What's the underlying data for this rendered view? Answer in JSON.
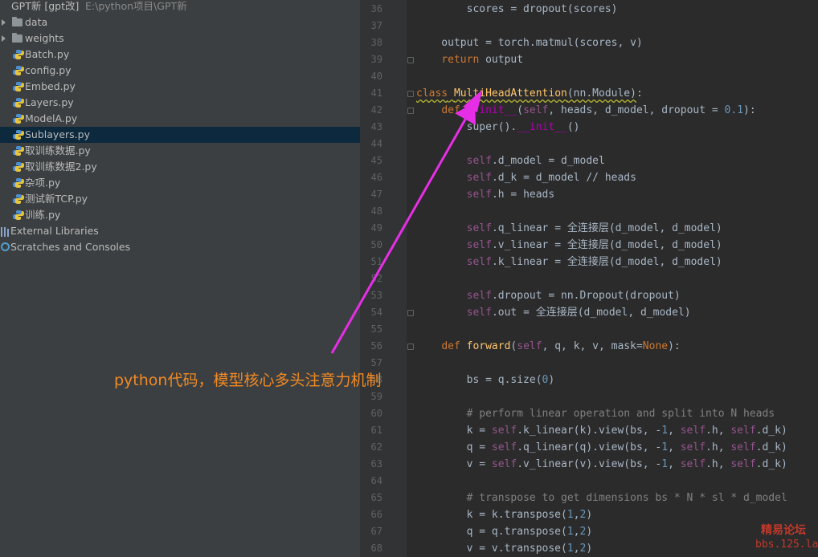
{
  "project_tree": {
    "root": {
      "name": "GPT新 [gpt改]",
      "path": "E:\\python项目\\GPT新"
    },
    "items": [
      {
        "label": "data",
        "type": "folder"
      },
      {
        "label": "weights",
        "type": "folder"
      },
      {
        "label": "Batch.py",
        "type": "py"
      },
      {
        "label": "config.py",
        "type": "py"
      },
      {
        "label": "Embed.py",
        "type": "py"
      },
      {
        "label": "Layers.py",
        "type": "py"
      },
      {
        "label": "ModelA.py",
        "type": "py"
      },
      {
        "label": "Sublayers.py",
        "type": "py",
        "selected": true
      },
      {
        "label": "取训练数据.py",
        "type": "py"
      },
      {
        "label": "取训练数据2.py",
        "type": "py"
      },
      {
        "label": "杂项.py",
        "type": "py"
      },
      {
        "label": "测试新TCP.py",
        "type": "py"
      },
      {
        "label": "训练.py",
        "type": "py"
      },
      {
        "label": "External Libraries",
        "type": "lib"
      },
      {
        "label": "Scratches and Consoles",
        "type": "scratch"
      }
    ]
  },
  "editor": {
    "lines": [
      {
        "n": "36",
        "text": "        scores = dropout(scores)"
      },
      {
        "n": "37",
        "text": ""
      },
      {
        "n": "38",
        "text": "    output = torch.matmul(scores, v)"
      },
      {
        "n": "39",
        "text": "    return output"
      },
      {
        "n": "40",
        "text": ""
      },
      {
        "n": "41",
        "text": "class MultiHeadAttention(nn.Module):"
      },
      {
        "n": "42",
        "text": "    def __init__(self, heads, d_model, dropout = 0.1):"
      },
      {
        "n": "43",
        "text": "        super().__init__()"
      },
      {
        "n": "44",
        "text": ""
      },
      {
        "n": "45",
        "text": "        self.d_model = d_model"
      },
      {
        "n": "46",
        "text": "        self.d_k = d_model // heads"
      },
      {
        "n": "47",
        "text": "        self.h = heads"
      },
      {
        "n": "48",
        "text": ""
      },
      {
        "n": "49",
        "text": "        self.q_linear = 全连接层(d_model, d_model)"
      },
      {
        "n": "50",
        "text": "        self.v_linear = 全连接层(d_model, d_model)"
      },
      {
        "n": "51",
        "text": "        self.k_linear = 全连接层(d_model, d_model)"
      },
      {
        "n": "52",
        "text": ""
      },
      {
        "n": "53",
        "text": "        self.dropout = nn.Dropout(dropout)"
      },
      {
        "n": "54",
        "text": "        self.out = 全连接层(d_model, d_model)"
      },
      {
        "n": "55",
        "text": ""
      },
      {
        "n": "56",
        "text": "    def forward(self, q, k, v, mask=None):"
      },
      {
        "n": "57",
        "text": ""
      },
      {
        "n": "58",
        "text": "        bs = q.size(0)"
      },
      {
        "n": "59",
        "text": ""
      },
      {
        "n": "60",
        "text": "        # perform linear operation and split into N heads"
      },
      {
        "n": "61",
        "text": "        k = self.k_linear(k).view(bs, -1, self.h, self.d_k)"
      },
      {
        "n": "62",
        "text": "        q = self.q_linear(q).view(bs, -1, self.h, self.d_k)"
      },
      {
        "n": "63",
        "text": "        v = self.v_linear(v).view(bs, -1, self.h, self.d_k)"
      },
      {
        "n": "64",
        "text": ""
      },
      {
        "n": "65",
        "text": "        # transpose to get dimensions bs * N * sl * d_model"
      },
      {
        "n": "66",
        "text": "        k = k.transpose(1,2)"
      },
      {
        "n": "67",
        "text": "        q = q.transpose(1,2)"
      },
      {
        "n": "68",
        "text": "        v = v.transpose(1,2)"
      }
    ]
  },
  "annotation": {
    "text": "python代码，模型核心多头注意力机制",
    "color": "#f08a24",
    "arrow_color": "#e62ee6"
  },
  "watermark": {
    "line1": "精易论坛",
    "line2": "bbs.125.la"
  },
  "colors": {
    "keyword": "#cc7832",
    "function": "#ffc66d",
    "self": "#94558d",
    "number": "#6897bb",
    "comment": "#808080",
    "text": "#a9b7c6",
    "selection": "#0d293e"
  }
}
